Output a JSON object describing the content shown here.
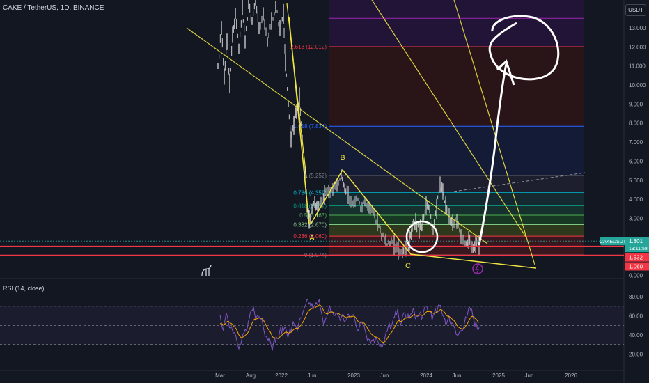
{
  "header": {
    "symbol": "CAKE / TetherUS, 1D, BINANCE",
    "currency": "USDT"
  },
  "rsi_panel": {
    "title": "RSI (14, close)"
  },
  "price_tags": {
    "symbol": "CAKEUSDT",
    "price": "1.801",
    "countdown": "13:11:58",
    "line1": "1.532",
    "line2": "1.060"
  },
  "colors": {
    "background": "#131722",
    "trendline": "#f0e442",
    "fib_line": "#2962ff",
    "support": "#f23645",
    "rsi_line": "#7e57c2",
    "rsi_ma": "#f7a600",
    "price_tag": "#26a69a"
  },
  "chart_data": [
    {
      "type": "line",
      "name": "price-chart",
      "x_ticks": [
        "Mar",
        "Aug",
        "2022",
        "Jun",
        "2023",
        "Jun",
        "2024",
        "Jun",
        "2025",
        "Jun",
        "2026"
      ],
      "y_ticks": [
        "13.000",
        "12.000",
        "11.000",
        "10.000",
        "9.000",
        "8.000",
        "7.000",
        "6.000",
        "5.000",
        "4.000",
        "3.000",
        "0.000"
      ],
      "fib_levels": [
        {
          "label": "0 (1.074)",
          "value": 1.074,
          "fill": "#131722",
          "line": "#787b86"
        },
        {
          "label": "0.236 (2.060)",
          "value": 2.06,
          "fill": "#3b1720",
          "line": "#f23645"
        },
        {
          "label": "0.382 (2.670)",
          "value": 2.67,
          "fill": "#2f3a1c",
          "line": "#81c784"
        },
        {
          "label": "0.5 (3.163)",
          "value": 3.163,
          "fill": "#173b24",
          "line": "#4caf50"
        },
        {
          "label": "0.618 (3.659)",
          "value": 3.659,
          "fill": "#16332e",
          "line": "#089981"
        },
        {
          "label": "0.786 (4.359)",
          "value": 4.359,
          "fill": "#152a33",
          "line": "#00bcd4"
        },
        {
          "label": "1 (5.252)",
          "value": 5.252,
          "fill": "#1e2030",
          "line": "#787b86"
        },
        {
          "label": "1.618 (7.834)",
          "value": 7.834,
          "fill": "#141b38",
          "line": "#2962ff"
        },
        {
          "label": "2.618 (12.012)",
          "value": 12.012,
          "fill": "#2a1518",
          "line": "#f23645"
        },
        {
          "label": "",
          "value": 13.5,
          "fill": "#221438",
          "line": "#9c27b0"
        }
      ],
      "wave_labels": [
        "A",
        "B",
        "C"
      ],
      "support_levels": [
        1.532,
        1.06
      ],
      "current_price": 1.801
    },
    {
      "type": "line",
      "name": "rsi",
      "y_ticks": [
        "80.00",
        "60.00",
        "40.00",
        "20.00"
      ],
      "bands": [
        70,
        50,
        30
      ]
    }
  ]
}
